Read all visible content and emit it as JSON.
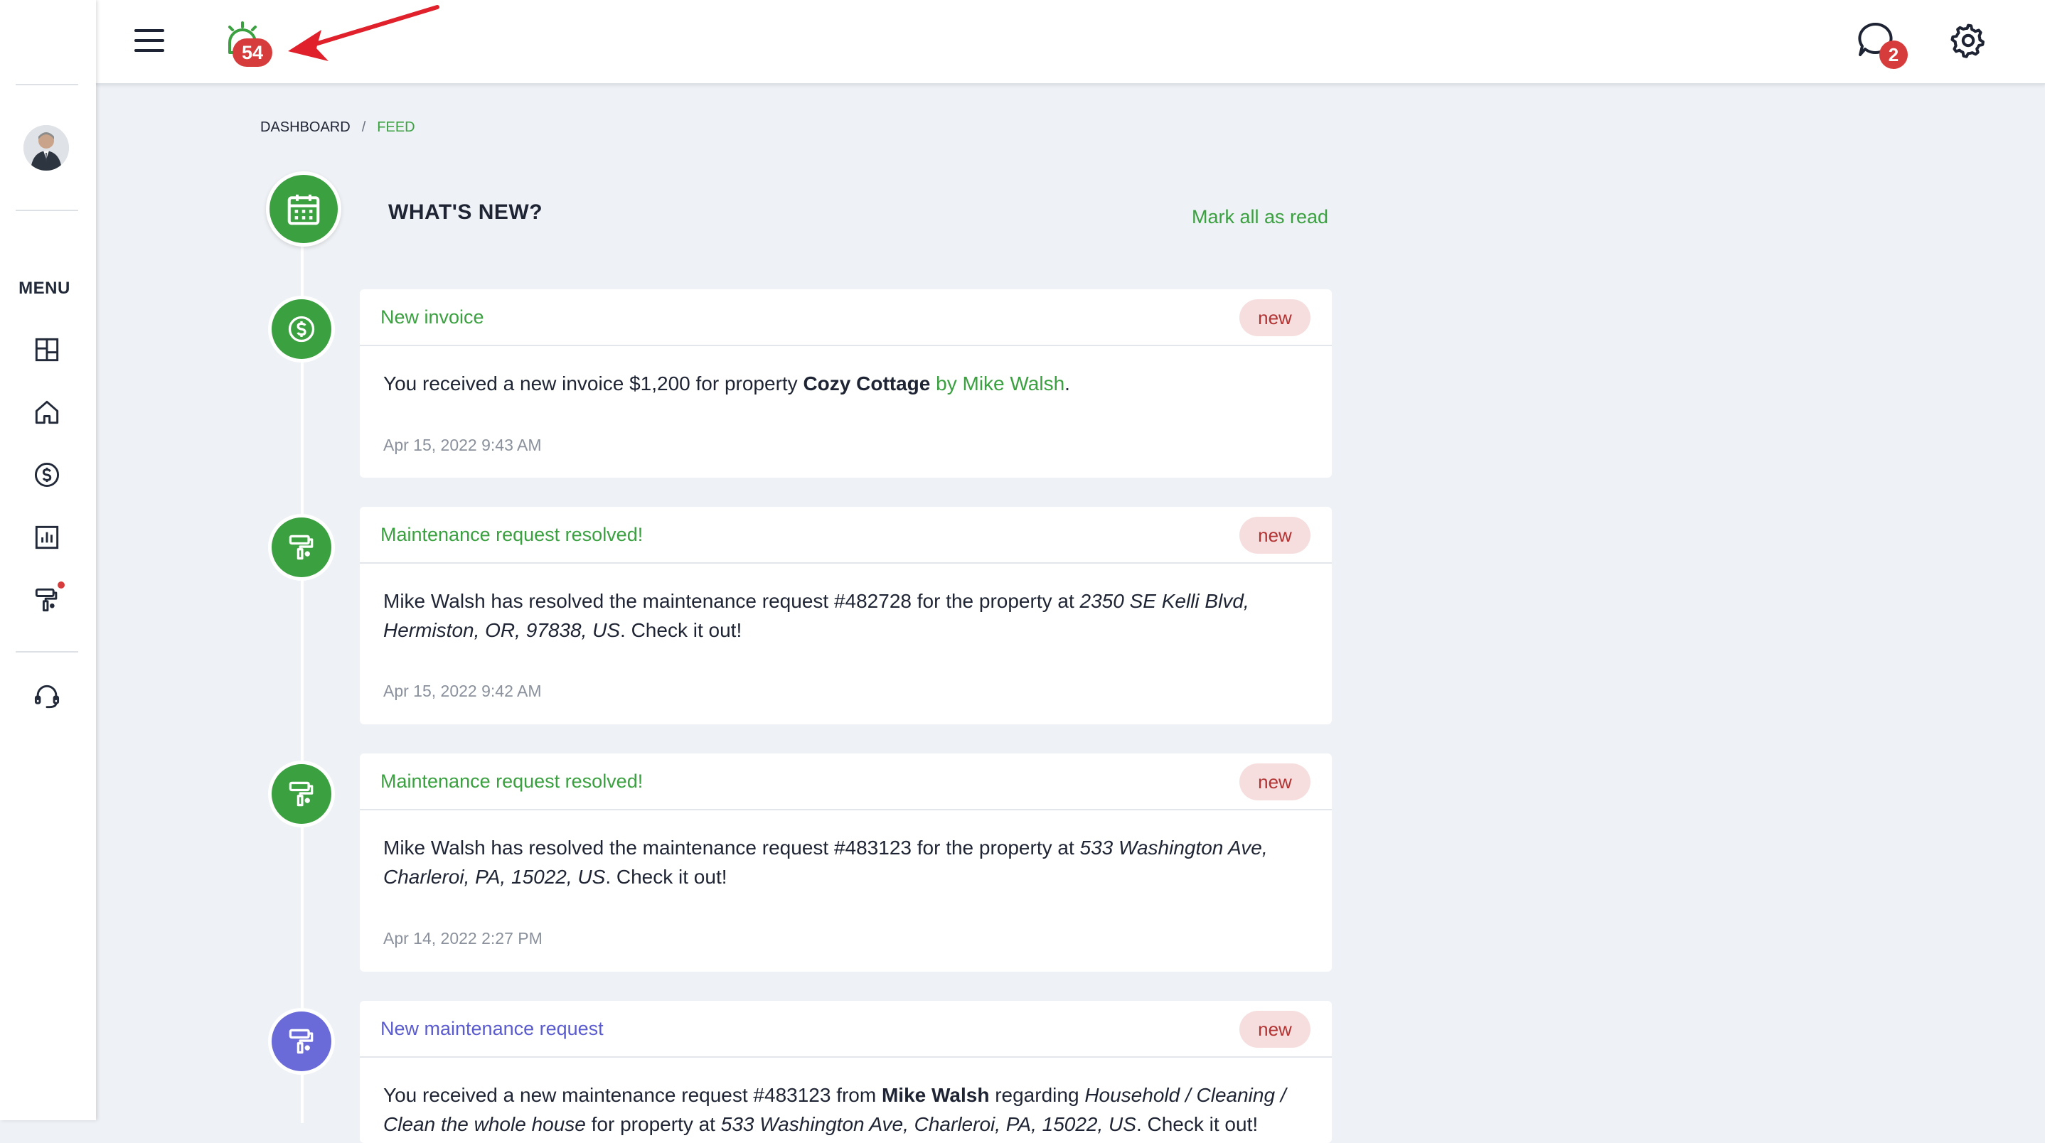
{
  "sidebar": {
    "menu_label": "MENU",
    "items": [
      {
        "icon": "dashboard-icon"
      },
      {
        "icon": "home-icon"
      },
      {
        "icon": "dollar-icon"
      },
      {
        "icon": "chart-icon"
      },
      {
        "icon": "paint-roller-icon"
      },
      {
        "icon": "headset-icon"
      }
    ]
  },
  "topbar": {
    "notifications_count": "54",
    "messages_count": "2"
  },
  "breadcrumb": {
    "root": "DASHBOARD",
    "separator": "/",
    "current": "FEED"
  },
  "feed": {
    "title": "WHAT'S NEW?",
    "mark_all_label": "Mark all as read",
    "items": [
      {
        "title": "New invoice",
        "badge": "new",
        "text_1": "You received a new invoice $1,200 for property ",
        "property": "Cozy Cottage",
        "by": " by Mike Walsh",
        "end": ".",
        "time": "Apr 15, 2022 9:43 AM"
      },
      {
        "title": "Maintenance request resolved!",
        "badge": "new",
        "text_1": "Mike Walsh has resolved the maintenance request #482728 for the property at ",
        "address": "2350 SE Kelli Blvd, Hermiston, OR, 97838, US",
        "end": ". Check it out!",
        "time": "Apr 15, 2022 9:42 AM"
      },
      {
        "title": "Maintenance request resolved!",
        "badge": "new",
        "text_1": "Mike Walsh has resolved the maintenance request #483123 for the property at ",
        "address": "533 Washington Ave, Charleroi, PA, 15022, US",
        "end": ". Check it out!",
        "time": "Apr 14, 2022 2:27 PM"
      },
      {
        "title": "New maintenance request",
        "badge": "new",
        "text_1": "You received a new maintenance request #483123 from ",
        "name": "Mike Walsh",
        "text_2": " regarding ",
        "category": "Household / Cleaning / Clean the whole house",
        "text_3": " for property at ",
        "address": "533 Washington Ave, Charleroi, PA, 15022, US",
        "end": ". Check it out!"
      }
    ]
  },
  "colors": {
    "accent_green": "#3aa040",
    "accent_purple": "#6a6ad8",
    "badge_red": "#d73c3c",
    "new_badge_bg": "#f7dede",
    "annotation_arrow": "#e0202a"
  }
}
